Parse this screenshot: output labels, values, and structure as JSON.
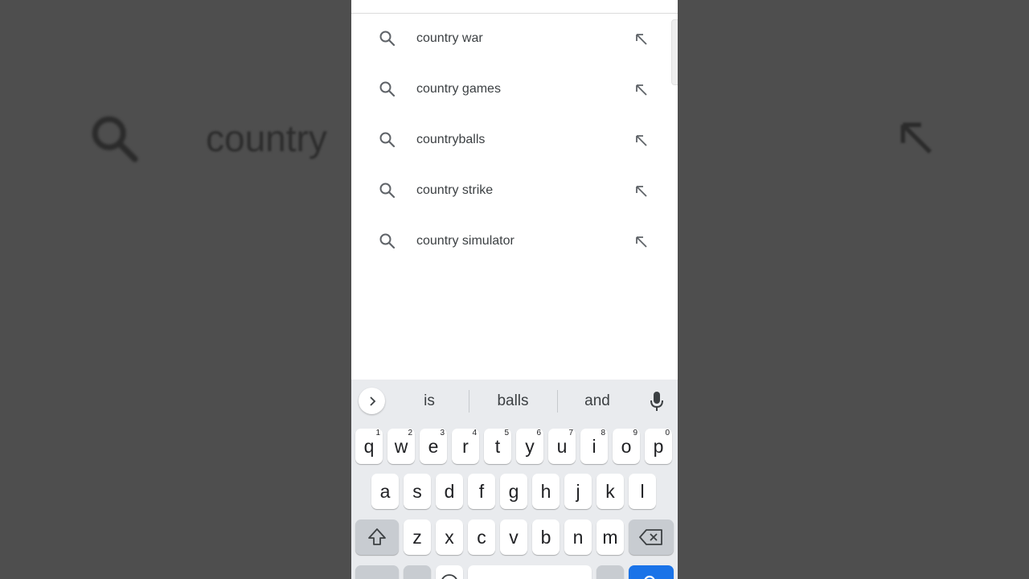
{
  "background_row": {
    "text": "country"
  },
  "suggestions": [
    {
      "text": "country war"
    },
    {
      "text": "country games"
    },
    {
      "text": "countryballs"
    },
    {
      "text": "country strike"
    },
    {
      "text": "country simulator"
    }
  ],
  "keyboard": {
    "word_suggestions": [
      "is",
      "balls",
      "and"
    ],
    "row1": [
      {
        "key": "q",
        "hint": "1"
      },
      {
        "key": "w",
        "hint": "2"
      },
      {
        "key": "e",
        "hint": "3"
      },
      {
        "key": "r",
        "hint": "4"
      },
      {
        "key": "t",
        "hint": "5"
      },
      {
        "key": "y",
        "hint": "6"
      },
      {
        "key": "u",
        "hint": "7"
      },
      {
        "key": "i",
        "hint": "8"
      },
      {
        "key": "o",
        "hint": "9"
      },
      {
        "key": "p",
        "hint": "0"
      }
    ],
    "row2": [
      "a",
      "s",
      "d",
      "f",
      "g",
      "h",
      "j",
      "k",
      "l"
    ],
    "row3": [
      "z",
      "x",
      "c",
      "v",
      "b",
      "n",
      "m"
    ],
    "accent_color": "#1a73e8"
  },
  "icons": {
    "suggestion_leading": "search-icon",
    "suggestion_trailing": "arrow-up-left-icon",
    "expand": "chevron-right-icon",
    "voice": "microphone-icon",
    "shift": "shift-icon",
    "backspace": "backspace-icon"
  }
}
